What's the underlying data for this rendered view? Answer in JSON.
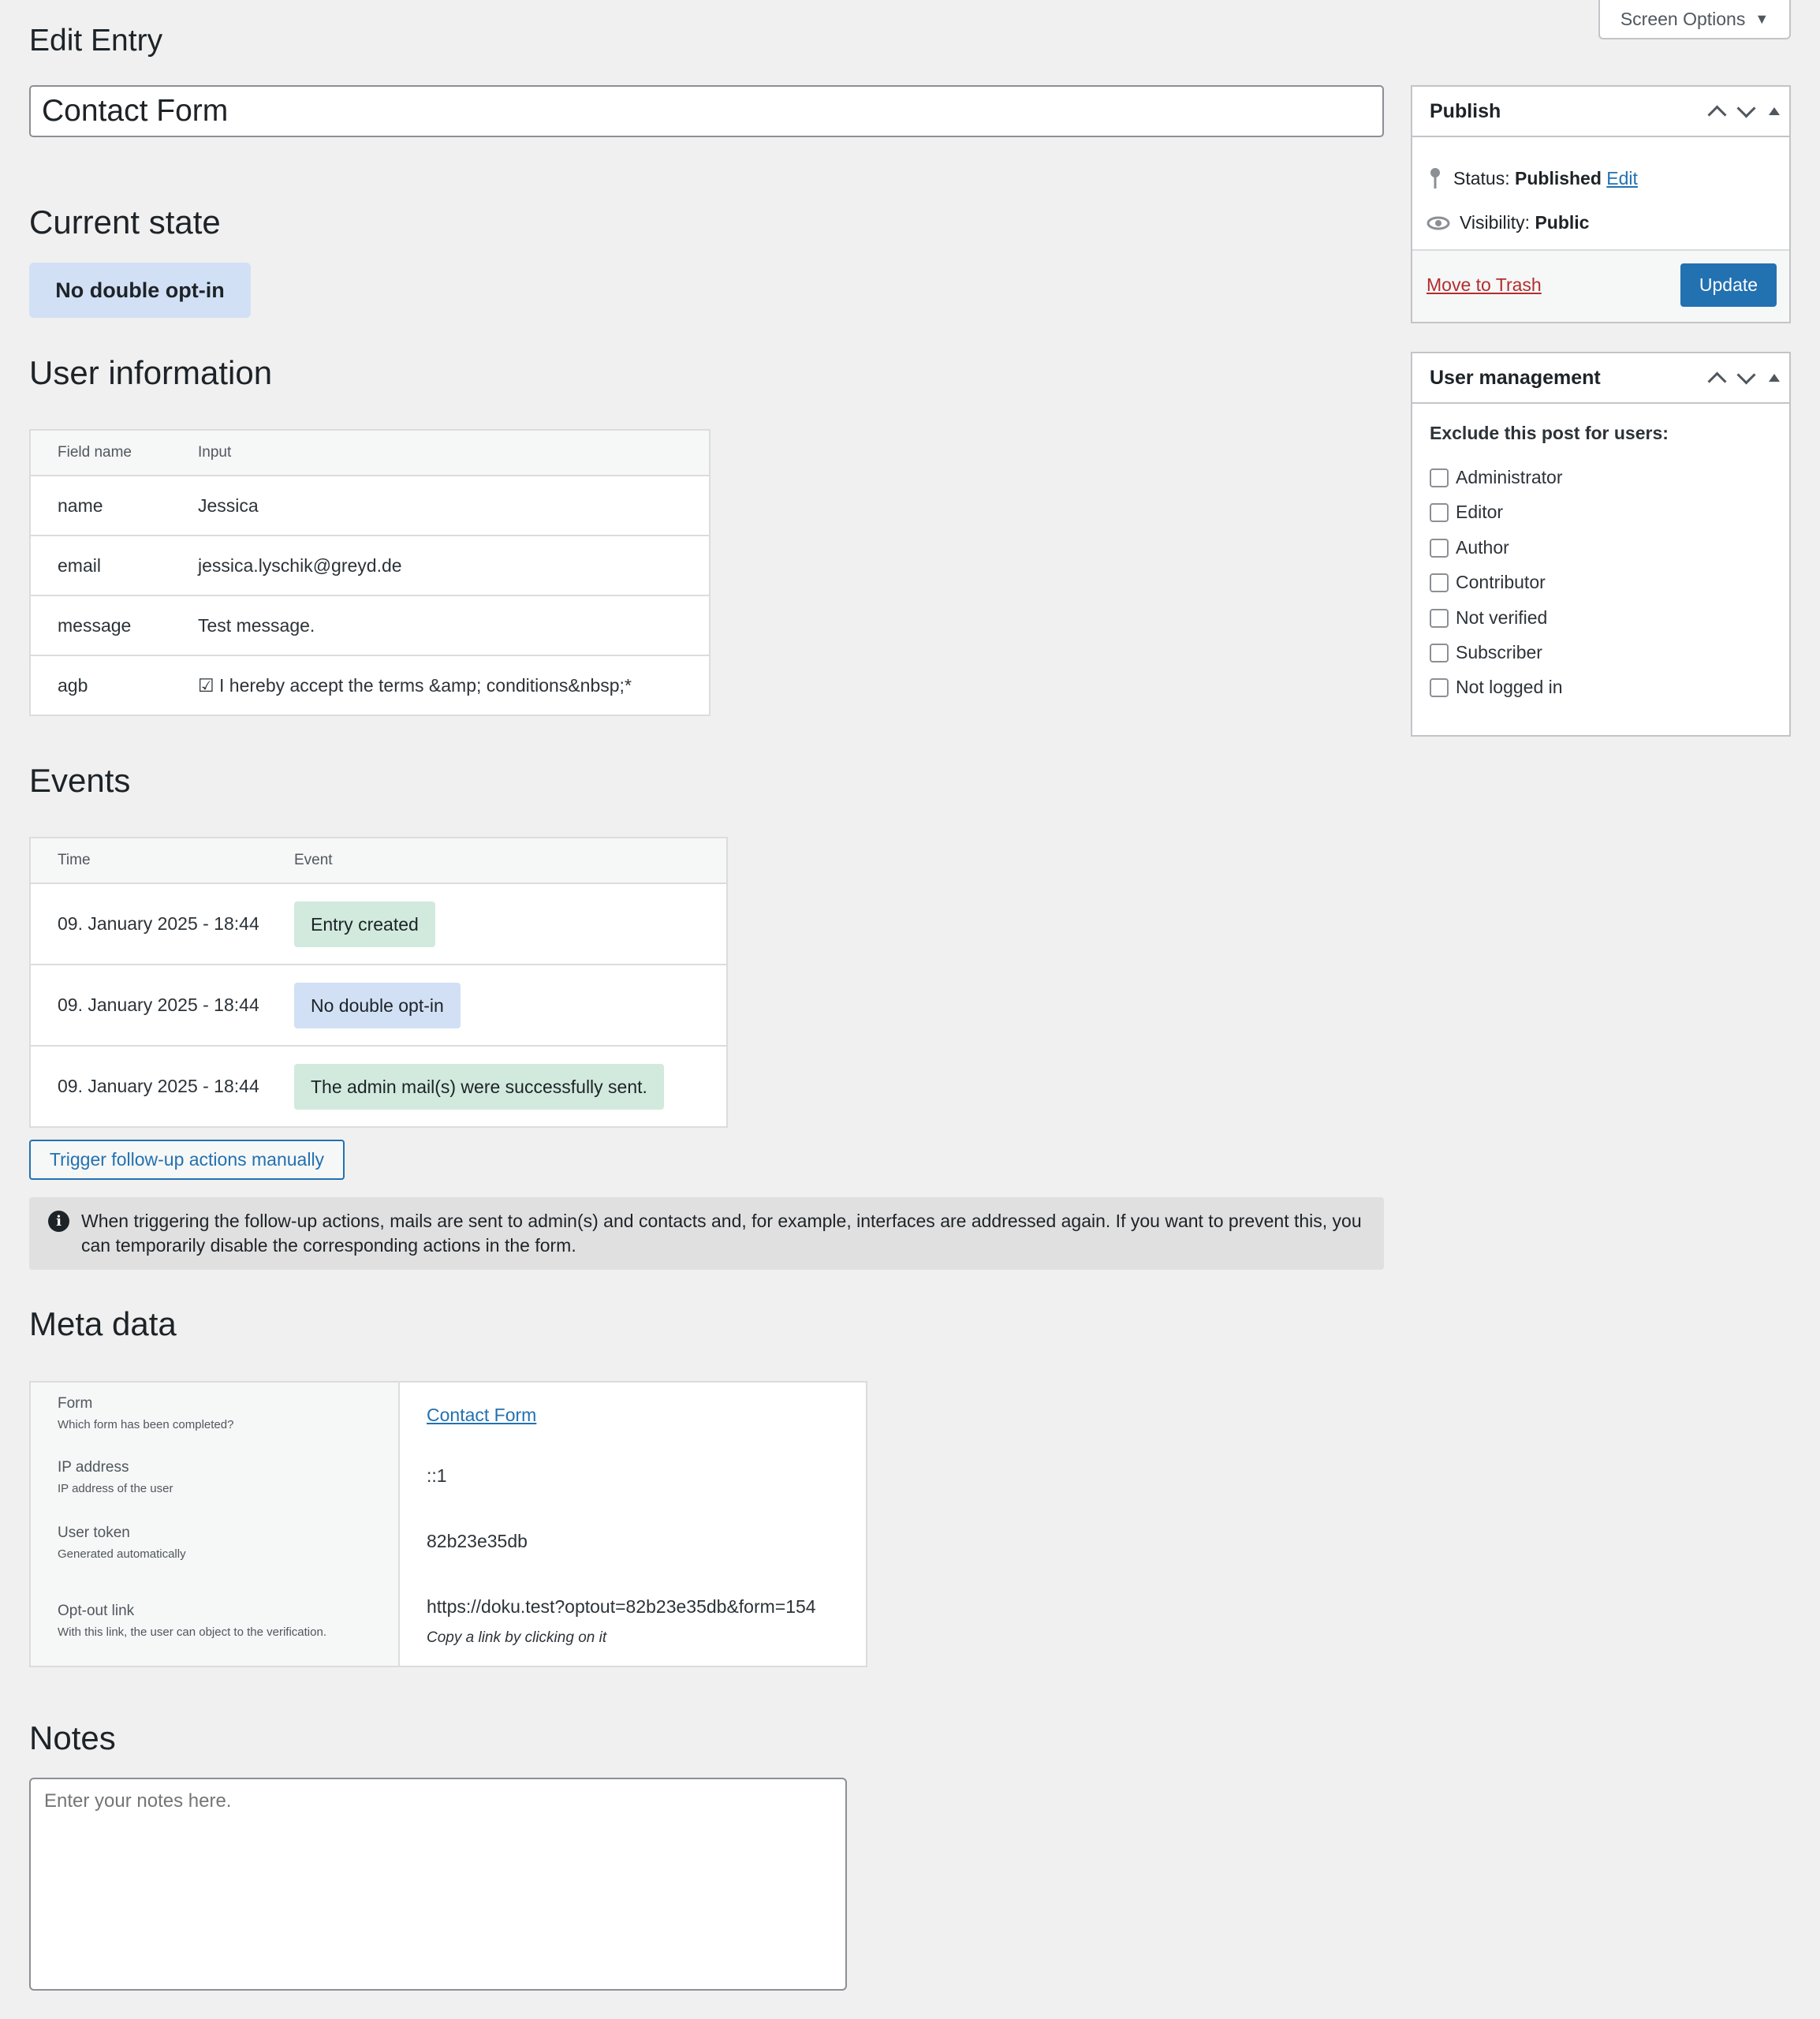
{
  "screen_options": {
    "label": "Screen Options",
    "caret": "▼"
  },
  "page_title": "Edit Entry",
  "entry_title": "Contact Form",
  "current_state": {
    "heading": "Current state",
    "badge": "No double opt-in"
  },
  "user_info": {
    "heading": "User information",
    "columns": [
      "Field name",
      "Input"
    ],
    "rows": [
      {
        "field": "name",
        "input": "Jessica"
      },
      {
        "field": "email",
        "input": "jessica.lyschik@greyd.de"
      },
      {
        "field": "message",
        "input": "Test message."
      },
      {
        "field": "agb",
        "input": "☑ I hereby accept the terms &amp; conditions&nbsp;*"
      }
    ]
  },
  "events": {
    "heading": "Events",
    "columns": [
      "Time",
      "Event"
    ],
    "rows": [
      {
        "time": "09. January 2025 - 18:44",
        "event": "Entry created",
        "color": "#d1eadd"
      },
      {
        "time": "09. January 2025 - 18:44",
        "event": "No double opt-in",
        "color": "#d2e0f5"
      },
      {
        "time": "09. January 2025 - 18:44",
        "event": "The admin mail(s) were successfully sent.",
        "color": "#d1eadd"
      }
    ]
  },
  "trigger_button": "Trigger follow-up actions manually",
  "notice": {
    "icon": "info-icon",
    "text": "When triggering the follow-up actions, mails are sent to admin(s) and contacts and, for example, interfaces are addressed again. If you want to prevent this, you can temporarily disable the corresponding actions in the form."
  },
  "meta_data": {
    "heading": "Meta data",
    "form": {
      "label": "Form",
      "desc": "Which form has been completed?",
      "value": "Contact Form"
    },
    "ip": {
      "label": "IP address",
      "desc": "IP address of the user",
      "value": "::1"
    },
    "token": {
      "label": "User token",
      "desc": "Generated automatically",
      "value": "82b23e35db"
    },
    "optout": {
      "label": "Opt-out link",
      "desc": "With this link, the user can object to the verification.",
      "value": "https://doku.test?optout=82b23e35db&form=154",
      "hint": "Copy a link by clicking on it"
    }
  },
  "notes": {
    "heading": "Notes",
    "placeholder": "Enter your notes here."
  },
  "publish": {
    "title": "Publish",
    "status_label": "Status:",
    "status_value": "Published",
    "status_edit": "Edit",
    "visibility_label": "Visibility:",
    "visibility_value": "Public",
    "trash": "Move to Trash",
    "update": "Update"
  },
  "user_management": {
    "title": "User management",
    "exclude_label": "Exclude this post for users:",
    "roles": [
      "Administrator",
      "Editor",
      "Author",
      "Contributor",
      "Not verified",
      "Subscriber",
      "Not logged in"
    ]
  },
  "colors": {
    "accent": "#2271b1",
    "danger": "#b32d2e",
    "badge_blue": "#d2e0f5",
    "badge_green": "#d1eadd"
  }
}
